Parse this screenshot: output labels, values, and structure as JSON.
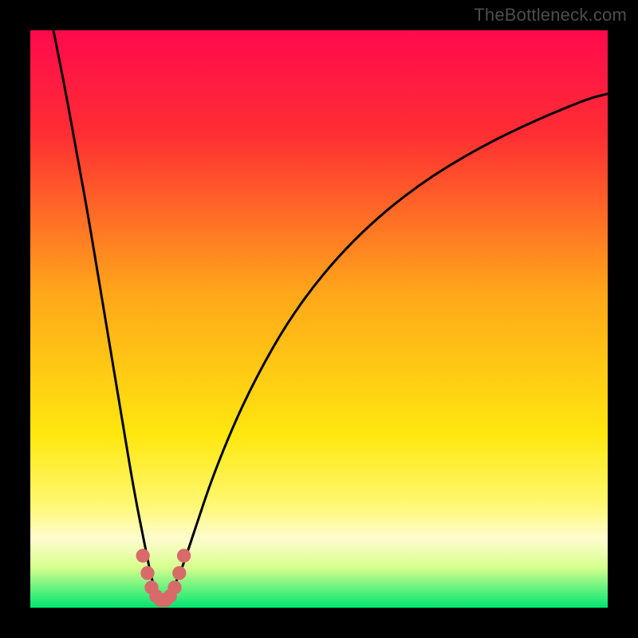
{
  "watermark": "TheBottleneck.com",
  "chart_data": {
    "type": "line",
    "title": "",
    "xlabel": "",
    "ylabel": "",
    "xlim": [
      0,
      100
    ],
    "ylim": [
      0,
      100
    ],
    "grid": false,
    "legend": false,
    "gradient_stops": [
      {
        "offset": 0,
        "color": "#ff0a4d"
      },
      {
        "offset": 18,
        "color": "#ff2e33"
      },
      {
        "offset": 45,
        "color": "#ffa51a"
      },
      {
        "offset": 70,
        "color": "#ffe70f"
      },
      {
        "offset": 82,
        "color": "#fff870"
      },
      {
        "offset": 88,
        "color": "#fffccf"
      },
      {
        "offset": 93,
        "color": "#d7ff8e"
      },
      {
        "offset": 100,
        "color": "#00e66f"
      }
    ],
    "series": [
      {
        "name": "bottleneck-curve",
        "x": [
          4,
          6,
          8,
          10,
          12,
          14,
          16,
          18,
          20,
          21,
          22,
          23,
          24,
          26,
          28,
          32,
          38,
          46,
          56,
          68,
          82,
          96,
          100
        ],
        "y": [
          100,
          90,
          79,
          68,
          56,
          44,
          32,
          20,
          10,
          5,
          2,
          1,
          2,
          6,
          12,
          24,
          38,
          52,
          64,
          74,
          82,
          88,
          89
        ]
      }
    ],
    "markers": {
      "name": "highlight-dots",
      "color": "#d86a6a",
      "radius_pct": 1.2,
      "points": [
        {
          "x": 19.5,
          "y": 9
        },
        {
          "x": 20.3,
          "y": 6
        },
        {
          "x": 21.0,
          "y": 3.5
        },
        {
          "x": 21.8,
          "y": 2
        },
        {
          "x": 22.6,
          "y": 1.3
        },
        {
          "x": 23.4,
          "y": 1.3
        },
        {
          "x": 24.2,
          "y": 2
        },
        {
          "x": 25.0,
          "y": 3.5
        },
        {
          "x": 25.8,
          "y": 6
        },
        {
          "x": 26.6,
          "y": 9
        }
      ]
    }
  }
}
